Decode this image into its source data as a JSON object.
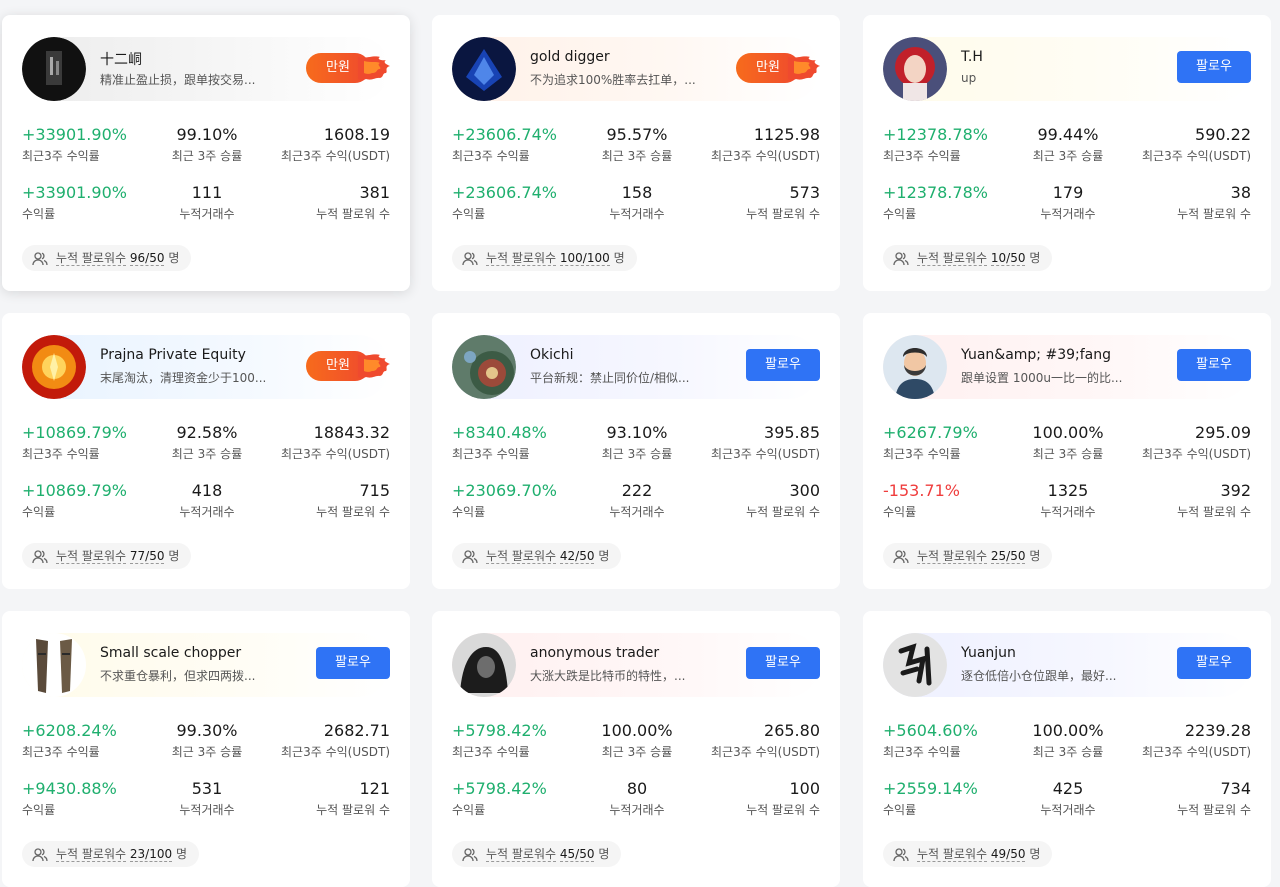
{
  "full_label": "만원",
  "follow_label": "팔로우",
  "labels": {
    "roi3w": "최근3주 수익률",
    "winrate3w": "최근 3주 승률",
    "profit3w": "최근3주 수익(USDT)",
    "roi": "수익률",
    "trades": "누적거래수",
    "followers": "누적 팔로워 수",
    "current_followers": "누적 팔로워수",
    "unit": "명"
  },
  "colors": {
    "accent": "#2f73f5",
    "positive": "#1faf6e",
    "negative": "#ef3d3d",
    "full": "#f76b1c"
  },
  "traders": [
    {
      "name": "十二峒",
      "desc": "精准止盈止损，跟单按交易...",
      "status": "full",
      "roi3w": "+33901.90%",
      "winrate3w": "99.10%",
      "profit3w": "1608.19",
      "roi": "+33901.90%",
      "roi_sign": "pos",
      "trades": "111",
      "followers": "381",
      "current": "96/50",
      "avatar_icon": "dark-figure-avatar"
    },
    {
      "name": "gold digger",
      "desc": "不为追求100%胜率去扛单，...",
      "status": "full",
      "roi3w": "+23606.74%",
      "winrate3w": "95.57%",
      "profit3w": "1125.98",
      "roi": "+23606.74%",
      "roi_sign": "pos",
      "trades": "158",
      "followers": "573",
      "current": "100/100",
      "avatar_icon": "blue-crystal-avatar"
    },
    {
      "name": "T.H",
      "desc": "up",
      "status": "follow",
      "roi3w": "+12378.78%",
      "winrate3w": "99.44%",
      "profit3w": "590.22",
      "roi": "+12378.78%",
      "roi_sign": "pos",
      "trades": "179",
      "followers": "38",
      "current": "10/50",
      "avatar_icon": "red-hair-avatar"
    },
    {
      "name": "Prajna Private Equity",
      "desc": "末尾淘汰，清理资金少于100...",
      "status": "full",
      "roi3w": "+10869.79%",
      "winrate3w": "92.58%",
      "profit3w": "18843.32",
      "roi": "+10869.79%",
      "roi_sign": "pos",
      "trades": "418",
      "followers": "715",
      "current": "77/50",
      "avatar_icon": "golden-buddha-avatar"
    },
    {
      "name": "Okichi",
      "desc": "平台新规：禁止同价位/相似...",
      "status": "follow",
      "roi3w": "+8340.48%",
      "winrate3w": "93.10%",
      "profit3w": "395.85",
      "roi": "+23069.70%",
      "roi_sign": "pos",
      "trades": "222",
      "followers": "300",
      "current": "42/50",
      "avatar_icon": "roulette-avatar"
    },
    {
      "name": "Yuan&amp; #39;fang",
      "desc": "跟单设置 1000u一比一的比...",
      "status": "follow",
      "roi3w": "+6267.79%",
      "winrate3w": "100.00%",
      "profit3w": "295.09",
      "roi": "-153.71%",
      "roi_sign": "neg",
      "trades": "1325",
      "followers": "392",
      "current": "25/50",
      "avatar_icon": "bearded-man-avatar"
    },
    {
      "name": "Small scale chopper",
      "desc": "不求重仓暴利，但求四两拨...",
      "status": "follow",
      "roi3w": "+6208.24%",
      "winrate3w": "99.30%",
      "profit3w": "2682.71",
      "roi": "+9430.88%",
      "roi_sign": "pos",
      "trades": "531",
      "followers": "121",
      "current": "23/100",
      "avatar_icon": "bracers-avatar"
    },
    {
      "name": "anonymous trader",
      "desc": "大涨大跌是比特币的特性，...",
      "status": "follow",
      "roi3w": "+5798.42%",
      "winrate3w": "100.00%",
      "profit3w": "265.80",
      "roi": "+5798.42%",
      "roi_sign": "pos",
      "trades": "80",
      "followers": "100",
      "current": "45/50",
      "avatar_icon": "hooded-figure-avatar"
    },
    {
      "name": "Yuanjun",
      "desc": "逐仓低倍小仓位跟单，最好...",
      "status": "follow",
      "roi3w": "+5604.60%",
      "winrate3w": "100.00%",
      "profit3w": "2239.28",
      "roi": "+2559.14%",
      "roi_sign": "pos",
      "trades": "425",
      "followers": "734",
      "current": "49/50",
      "avatar_icon": "calligraphy-avatar"
    }
  ]
}
